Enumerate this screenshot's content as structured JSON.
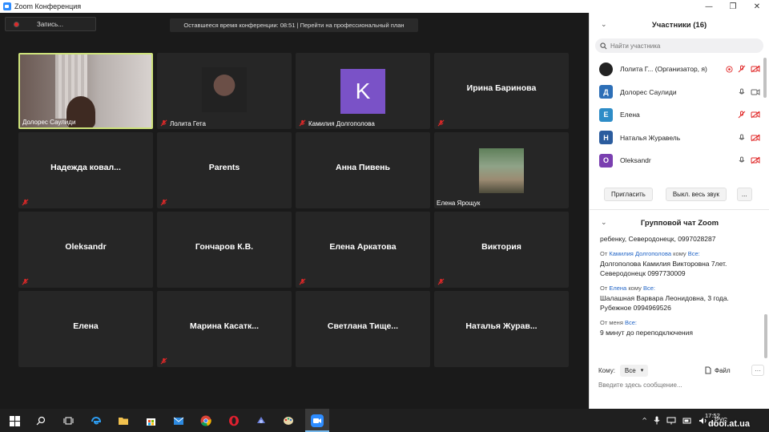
{
  "window": {
    "title": "Zoom Конференция",
    "btn_min": "—",
    "btn_max": "❐",
    "btn_close": "✕"
  },
  "meeting": {
    "record_label": "Запись...",
    "banner": "Оставшееся время конференции: 08:51 | Перейти на профессиональный план"
  },
  "tiles": [
    {
      "name": "",
      "label": "Долорес Саулиди"
    },
    {
      "name": "",
      "label": "Лолита Гета"
    },
    {
      "name": "",
      "label": "Камилия Долгополова",
      "avatar_letter": "K"
    },
    {
      "name": "Ирина Баринова",
      "label": ""
    },
    {
      "name": "Надежда  ковал...",
      "label": ""
    },
    {
      "name": "Parents",
      "label": ""
    },
    {
      "name": "Анна Пивень",
      "label": ""
    },
    {
      "name": "",
      "label": "Елена Ярощук"
    },
    {
      "name": "Oleksandr",
      "label": ""
    },
    {
      "name": "Гончаров К.В.",
      "label": ""
    },
    {
      "name": "Елена Аркатова",
      "label": ""
    },
    {
      "name": "Виктория",
      "label": ""
    },
    {
      "name": "Елена",
      "label": ""
    },
    {
      "name": "Марина  Касатк...",
      "label": ""
    },
    {
      "name": "Светлана  Тище...",
      "label": ""
    },
    {
      "name": "Наталья  Журав...",
      "label": ""
    }
  ],
  "participants_panel": {
    "title": "Участники (16)",
    "search_placeholder": "Найти участника",
    "participants": [
      {
        "letter": "",
        "name": "Лолита Г...  (Организатор, я)",
        "color": "#222222"
      },
      {
        "letter": "Д",
        "name": "Долорес Саулиди",
        "color": "#2d6fb7"
      },
      {
        "letter": "Е",
        "name": "Елена",
        "color": "#2d8cc7"
      },
      {
        "letter": "Н",
        "name": "Наталья Журавель",
        "color": "#2b5c9e"
      },
      {
        "letter": "O",
        "name": "Oleksandr",
        "color": "#7a3fb0"
      }
    ],
    "invite_label": "Пригласить",
    "mute_all_label": "Выкл. весь звук",
    "more_label": "..."
  },
  "chat": {
    "title": "Групповой чат Zoom",
    "messages": [
      {
        "from_prefix": "",
        "from": "",
        "to_word": "",
        "to": "",
        "text": "ребенку, Северодонецк, 0997028287"
      },
      {
        "from_prefix": "От ",
        "from": "Камилия Долгополова",
        "to_word": " кому ",
        "to": "Все:",
        "text": "Долгополова Камилия Викторовна 7лет. Северодонецк 0997730009"
      },
      {
        "from_prefix": "От ",
        "from": "Елена",
        "to_word": " кому ",
        "to": "Все:",
        "text": "Шалашная Варвара Леонидовна, 3 года. Рубежное 0994969526"
      },
      {
        "from_prefix": "От меня ",
        "from": "",
        "to_word": "",
        "to": "Все:",
        "text": "9 минут до переподключения"
      }
    ],
    "to_label": "Кому:",
    "to_value": "Все",
    "file_label": "Файл",
    "more_label": "···",
    "input_placeholder": "Введите здесь сообщение..."
  },
  "taskbar": {
    "lang": "РУС",
    "time": "17:52",
    "date": "20",
    "watermark": "dooi.at.ua"
  },
  "colors": {
    "accent": "#2d8cff",
    "active_border": "#cde27a",
    "mute_red": "#e02828"
  }
}
